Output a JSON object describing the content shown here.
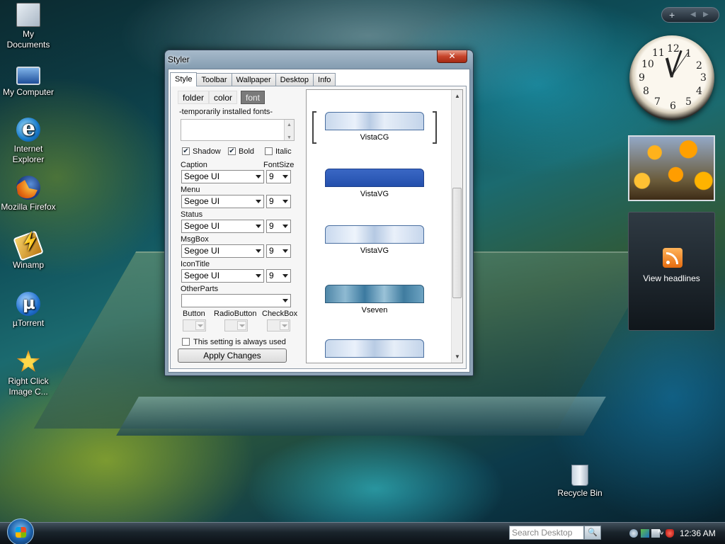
{
  "desktop": {
    "icons": [
      {
        "label": "My\nDocuments",
        "icon": "my-documents-icon"
      },
      {
        "label": "My Computer",
        "icon": "my-computer-icon"
      },
      {
        "label": "Internet\nExplorer",
        "icon": "internet-explorer-icon"
      },
      {
        "label": "Mozilla Firefox",
        "icon": "firefox-icon"
      },
      {
        "label": "Winamp",
        "icon": "winamp-icon"
      },
      {
        "label": "µTorrent",
        "icon": "utorrent-icon"
      },
      {
        "label": "Right Click\nImage C...",
        "icon": "right-click-image-icon"
      },
      {
        "label": "Recycle Bin",
        "icon": "recycle-bin-icon"
      }
    ]
  },
  "window": {
    "title": "Styler",
    "close_label": "✕",
    "tabs": [
      "Style",
      "Toolbar",
      "Wallpaper",
      "Desktop",
      "Info"
    ],
    "active_tab": "Style",
    "subtabs": [
      "folder",
      "color",
      "font"
    ],
    "active_subtab": "font",
    "fonts_group_label": "-temporarily installed fonts-",
    "checkboxes": [
      {
        "label": "Shadow",
        "checked": true
      },
      {
        "label": "Bold",
        "checked": true
      },
      {
        "label": "Italic",
        "checked": false
      }
    ],
    "fontsize_label": "FontSize",
    "font_rows": [
      {
        "label": "Caption",
        "font": "Segoe UI",
        "size": "9"
      },
      {
        "label": "Menu",
        "font": "Segoe UI",
        "size": "9"
      },
      {
        "label": "Status",
        "font": "Segoe UI",
        "size": "9"
      },
      {
        "label": "MsgBox",
        "font": "Segoe UI",
        "size": "9"
      },
      {
        "label": "IconTitle",
        "font": "Segoe UI",
        "size": "9"
      }
    ],
    "other_parts_label": "OtherParts",
    "other_parts_value": "",
    "mini_labels": [
      "Button",
      "RadioButton",
      "CheckBox"
    ],
    "always_used_label": "This setting is always used",
    "always_used_checked": false,
    "apply_label": "Apply Changes",
    "themes": [
      {
        "name": "VistaCG",
        "selected": true
      },
      {
        "name": "VistaVG",
        "selected": false
      },
      {
        "name": "VistaVG",
        "selected": false
      },
      {
        "name": "Vseven",
        "selected": false
      },
      {
        "name": "",
        "selected": false
      }
    ]
  },
  "sidebar": {
    "controls": [
      "+",
      "◀",
      "▶"
    ],
    "clock_numbers": [
      "12",
      "1",
      "2",
      "3",
      "4",
      "5",
      "6",
      "7",
      "8",
      "9",
      "10",
      "11"
    ],
    "feed_label": "View headlines"
  },
  "taskbar": {
    "search_placeholder": "Search Desktop",
    "time": "12:36 AM"
  },
  "colors": {
    "accent": "#1b5fa8",
    "close_button": "#c7442b",
    "theme_vistavg": "#2f5bb8"
  }
}
